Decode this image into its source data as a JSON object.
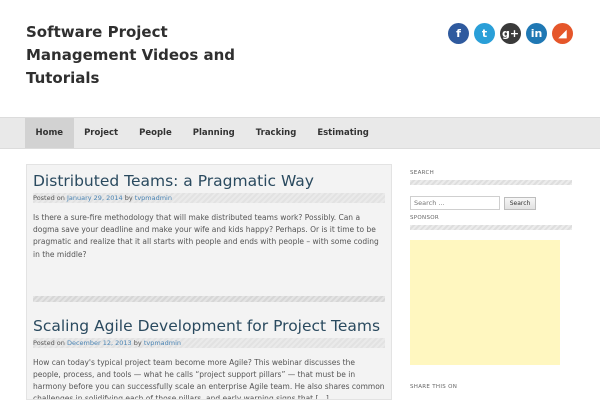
{
  "site": {
    "title": "Software Project Management Videos and Tutorials"
  },
  "social": [
    {
      "name": "facebook-icon",
      "glyph": "f",
      "color": "#2f5a9e"
    },
    {
      "name": "twitter-icon",
      "glyph": "t",
      "color": "#2a9fd8"
    },
    {
      "name": "google-plus-icon",
      "glyph": "g+",
      "color": "#3a3a3a"
    },
    {
      "name": "linkedin-icon",
      "glyph": "in",
      "color": "#1f78b4"
    },
    {
      "name": "rss-icon",
      "glyph": "◢",
      "color": "#e5562a"
    }
  ],
  "nav": {
    "items": [
      "Home",
      "Project",
      "People",
      "Planning",
      "Tracking",
      "Estimating"
    ],
    "active": 0
  },
  "posts": [
    {
      "title": "Distributed Teams: a Pragmatic Way",
      "posted_on": "Posted on",
      "date": "January 29, 2014",
      "by": "by",
      "author": "tvpmadmin",
      "excerpt": "Is there a sure-fire methodology that will make distributed teams work? Possibly. Can a dogma save your deadline and make your wife and kids happy? Perhaps. Or is it time to be pragmatic and realize that it all starts with people and ends with people – with some coding in the middle?"
    },
    {
      "title": "Scaling Agile Development for Project Teams",
      "posted_on": "Posted on",
      "date": "December 12, 2013",
      "by": "by",
      "author": "tvpmadmin",
      "excerpt": "How can today's typical project team become more Agile? This webinar discusses the people, process, and tools — what he calls “project support pillars” — that must be in harmony before you can successfully scale an enterprise Agile team. He also shares common challenges in solidifying each of those pillars, and early warning signs that […]"
    }
  ],
  "sidebar": {
    "search_title": "SEARCH",
    "search_placeholder": "Search ...",
    "search_button": "Search",
    "sponsor_title": "SPONSOR",
    "share_title": "SHARE THIS ON"
  },
  "colors": {
    "link": "#2a4a5f",
    "meta_link": "#4a84b4",
    "ad_background": "#fff7c0"
  }
}
